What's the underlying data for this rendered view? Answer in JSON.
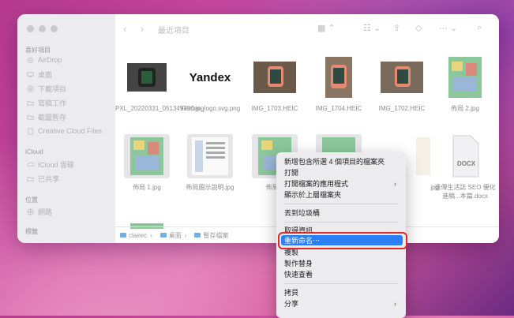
{
  "sidebar": {
    "favorites_title": "喜好項目",
    "favorites": [
      "AirDrop",
      "桌面",
      "下載項目",
      "寫稿工作",
      "截圖暫存",
      "Creative Cloud Files"
    ],
    "icloud_title": "iCloud",
    "icloud": [
      "iCloud 雲碟",
      "已共享"
    ],
    "locations_title": "位置",
    "locations": [
      "網路"
    ],
    "tags_title": "標籤"
  },
  "toolbar": {
    "title": "最近項目"
  },
  "files_row1": [
    "PXL_20220331_051349790.jpg",
    "Yandex_logo.svg.png",
    "IMG_1703.HEIC",
    "IMG_1704.HEIC",
    "IMG_1702.HEIC",
    "佈局 2.jpg"
  ],
  "files_row2": [
    "佈局 1.jpg",
    "佈局圖示說明.jpg",
    "佈局 4",
    "",
    "jpg",
    "遠傳生活誌 SEO 優化進稿...本篇.docx"
  ],
  "yandex_logo_text": "Yandex",
  "docx_badge": "DOCX",
  "pathbar": [
    "clairec",
    "桌面",
    "暫存檔案"
  ],
  "context_menu": {
    "items": [
      "新增包含所選 4 個項目的檔案夾",
      "打開",
      "打開檔案的應用程式",
      "顯示於上層檔案夾",
      "丟到垃圾桶",
      "取得資訊",
      "重新命名⋯",
      "複製",
      "製作替身",
      "快速查看",
      "拷貝",
      "分享"
    ],
    "submenu_arrow": "›"
  }
}
